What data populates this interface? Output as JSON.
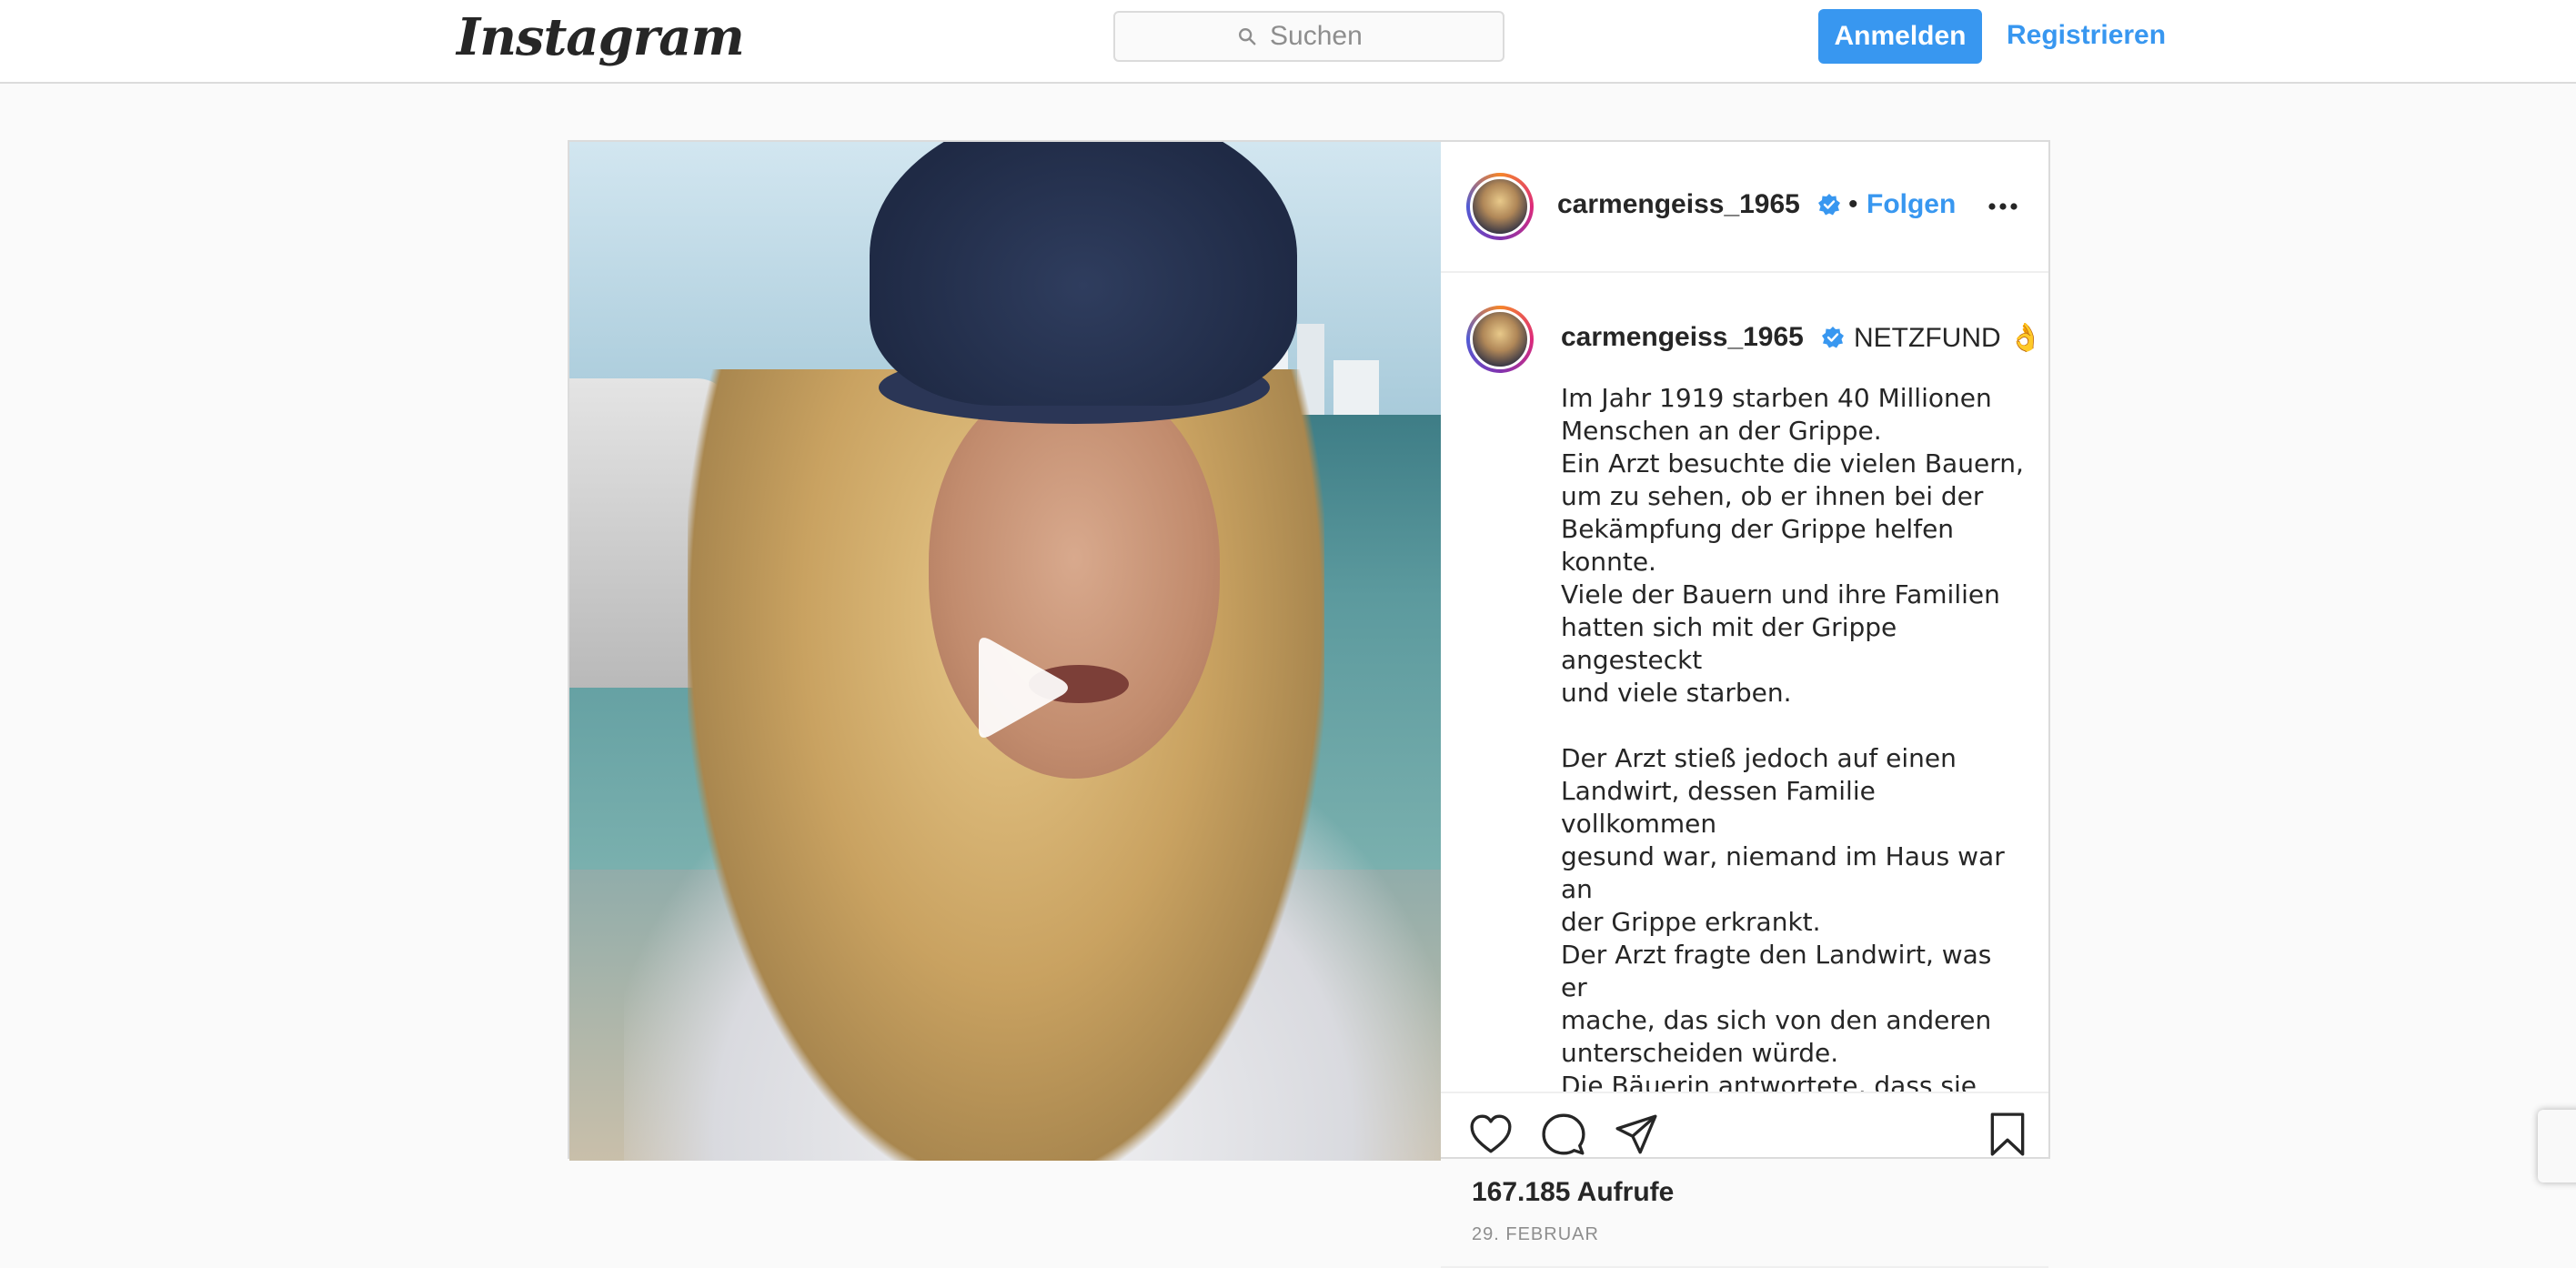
{
  "header": {
    "logo_text": "Instagram",
    "search_placeholder": "Suchen",
    "login_label": "Anmelden",
    "register_label": "Registrieren"
  },
  "post": {
    "username": "carmengeiss_1965",
    "follow_label": "Folgen",
    "dot": "•",
    "caption_headline": "NETZFUND 👌",
    "caption_text": "Im Jahr 1919 starben 40 Millionen\nMenschen an der Grippe.\nEin Arzt besuchte die vielen Bauern,\num zu sehen, ob er ihnen bei der\nBekämpfung der Grippe helfen konnte.\nViele der Bauern und ihre Familien\nhatten sich mit der Grippe angesteckt\nund viele starben.\n\nDer Arzt stieß jedoch auf einen\nLandwirt, dessen Familie vollkommen\ngesund war, niemand im Haus war an\nder Grippe erkrankt.\nDer Arzt fragte den Landwirt, was er\nmache, das sich von den anderen\nunterscheiden würde.\nDie Bäuerin antwortete, dass sie",
    "views": "167.185 Aufrufe",
    "date": "29. FEBRUAR"
  },
  "colors": {
    "accent": "#3897f0",
    "border": "#dbdbdb",
    "background": "#fafafa",
    "text": "#262626",
    "muted": "#8e8e8e"
  },
  "icons": {
    "search": "search-icon",
    "verified": "verified-badge-icon",
    "more": "more-options-icon",
    "like": "heart-icon",
    "comment": "comment-icon",
    "share": "share-icon",
    "save": "bookmark-icon",
    "play": "play-icon"
  }
}
